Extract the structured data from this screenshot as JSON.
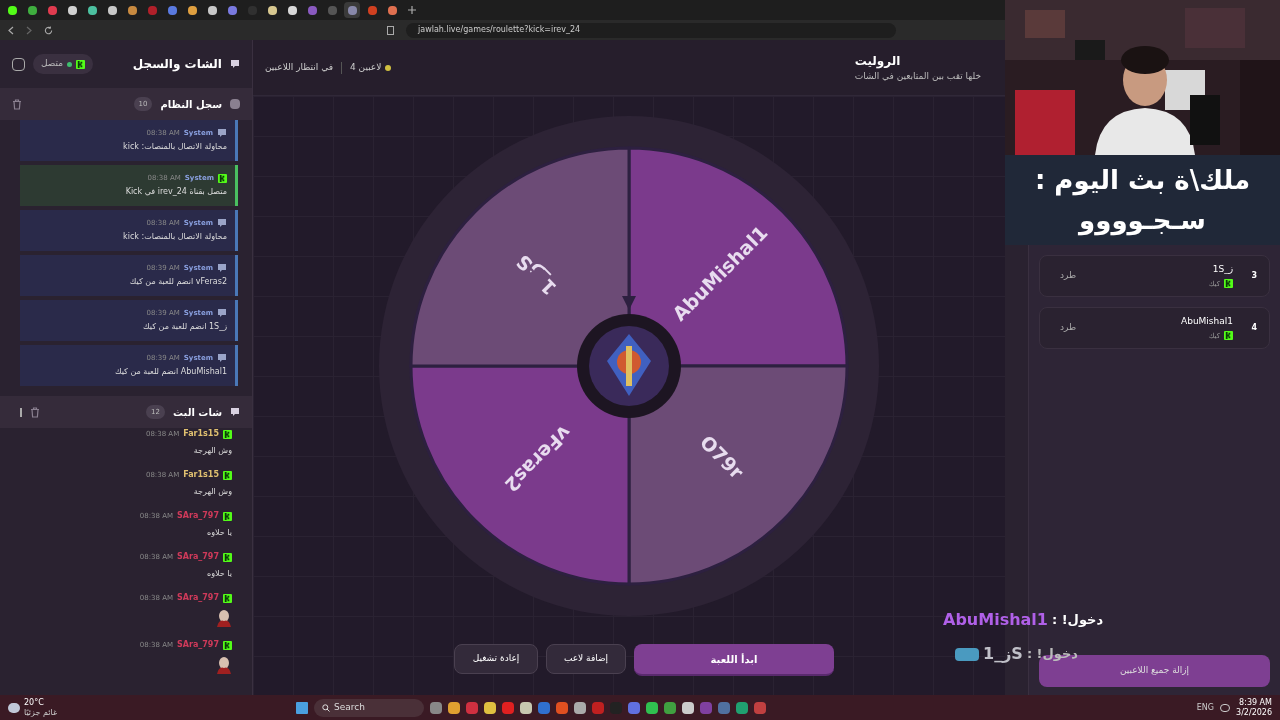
{
  "browser": {
    "address": "jawlah.live/games/roulette?kick=irev_24",
    "tabs": [
      {
        "color": "#53fc18",
        "selected": false
      },
      {
        "color": "#3fae3f",
        "selected": false
      },
      {
        "color": "#e03b4f",
        "selected": false
      },
      {
        "color": "#d0d0d0",
        "selected": false
      },
      {
        "color": "#4cc0a0",
        "selected": false
      },
      {
        "color": "#c8c8c8",
        "selected": false
      },
      {
        "color": "#c88a40",
        "selected": false
      },
      {
        "color": "#b0202a",
        "selected": false
      },
      {
        "color": "#5a7ae0",
        "selected": false
      },
      {
        "color": "#e0a040",
        "selected": false
      },
      {
        "color": "#c8c8c8",
        "selected": false
      },
      {
        "color": "#7a7ae0",
        "selected": false
      },
      {
        "color": "#303030",
        "selected": false
      },
      {
        "color": "#d8c890",
        "selected": false
      },
      {
        "color": "#d8d8d8",
        "selected": false
      },
      {
        "color": "#8a5ac0",
        "selected": false
      },
      {
        "color": "#555555",
        "selected": false
      },
      {
        "color": "#8888aa",
        "selected": true
      },
      {
        "color": "#d04020",
        "selected": false
      },
      {
        "color": "#e07050",
        "selected": false
      }
    ]
  },
  "sidebar": {
    "title": "الشات والسجل",
    "status": "متصل",
    "system_log": {
      "title": "سجل النظام",
      "count": "10",
      "entries": [
        {
          "sender": "System",
          "time": "08:38 AM",
          "text": "محاولة الاتصال بالمنصات: kick",
          "kind": "info"
        },
        {
          "sender": "System",
          "time": "08:38 AM",
          "text": "متصل بقناة irev_24 في Kick",
          "kind": "success"
        },
        {
          "sender": "System",
          "time": "08:38 AM",
          "text": "محاولة الاتصال بالمنصات: kick",
          "kind": "info"
        },
        {
          "sender": "System",
          "time": "08:39 AM",
          "text": "vFeras2 انضم للعبة من كيك",
          "kind": "info"
        },
        {
          "sender": "System",
          "time": "08:39 AM",
          "text": "ز_1S انضم للعبة من كيك",
          "kind": "info"
        },
        {
          "sender": "System",
          "time": "08:39 AM",
          "text": "AbuMishal1 انضم للعبة من كيك",
          "kind": "info"
        }
      ]
    },
    "stream_chat": {
      "title": "شات البث",
      "count": "12",
      "messages": [
        {
          "user": "Far1s15",
          "color": "#e0c070",
          "time": "08:38 AM",
          "text": "وش الهرجة",
          "kind": "text"
        },
        {
          "user": "Far1s15",
          "color": "#e0c070",
          "time": "08:38 AM",
          "text": "وش الهرجة",
          "kind": "text"
        },
        {
          "user": "SAra_797",
          "color": "#d03a5a",
          "time": "08:38 AM",
          "text": "يا حلاوه",
          "kind": "text"
        },
        {
          "user": "SAra_797",
          "color": "#d03a5a",
          "time": "08:38 AM",
          "text": "يا حلاوه",
          "kind": "text"
        },
        {
          "user": "SAra_797",
          "color": "#d03a5a",
          "time": "08:38 AM",
          "kind": "sticker"
        },
        {
          "user": "SAra_797",
          "color": "#d03a5a",
          "time": "08:38 AM",
          "kind": "sticker"
        }
      ]
    }
  },
  "header": {
    "title": "الروليت",
    "subtitle": "خلها تقب بين المتابعين في الشات",
    "players": "4 لاعبين",
    "status": "في انتظار اللاعبين"
  },
  "wheel": {
    "segments": [
      {
        "label": "AbuMishal1",
        "color": "#7b3a8c"
      },
      {
        "label": "O79r",
        "color": "#6c4b76"
      },
      {
        "label": "vFeras2",
        "color": "#7b3a8c"
      },
      {
        "label": "ز_1S",
        "color": "#6c4b76"
      }
    ]
  },
  "actions": {
    "start": "ابدأ اللعبة",
    "add": "إضافة لاعب",
    "restart": "إعادة تشغيل"
  },
  "players": {
    "items": [
      {
        "number": "3",
        "name": "ز_1S",
        "platform": "كيك",
        "action": "طرد"
      },
      {
        "number": "4",
        "name": "AbuMishal1",
        "platform": "كيك",
        "action": "طرد"
      }
    ],
    "remove_all": "إزالة جميع اللاعبين"
  },
  "overlay": {
    "banner": [
      "ملك\\ة بث اليوم :",
      "سـجـوووو"
    ],
    "alerts": [
      {
        "label": "دخول! :",
        "user": "AbuMishal1",
        "color": "#b060e8"
      },
      {
        "label": "دخول! :",
        "user": "ز_1S",
        "color": "#c0c0c8"
      }
    ]
  },
  "taskbar": {
    "temperature": "20°C",
    "weather": "غائم جزئيًا",
    "search": "Search",
    "language": "ENG",
    "time": "8:39 AM",
    "date": "3/2/2026"
  }
}
